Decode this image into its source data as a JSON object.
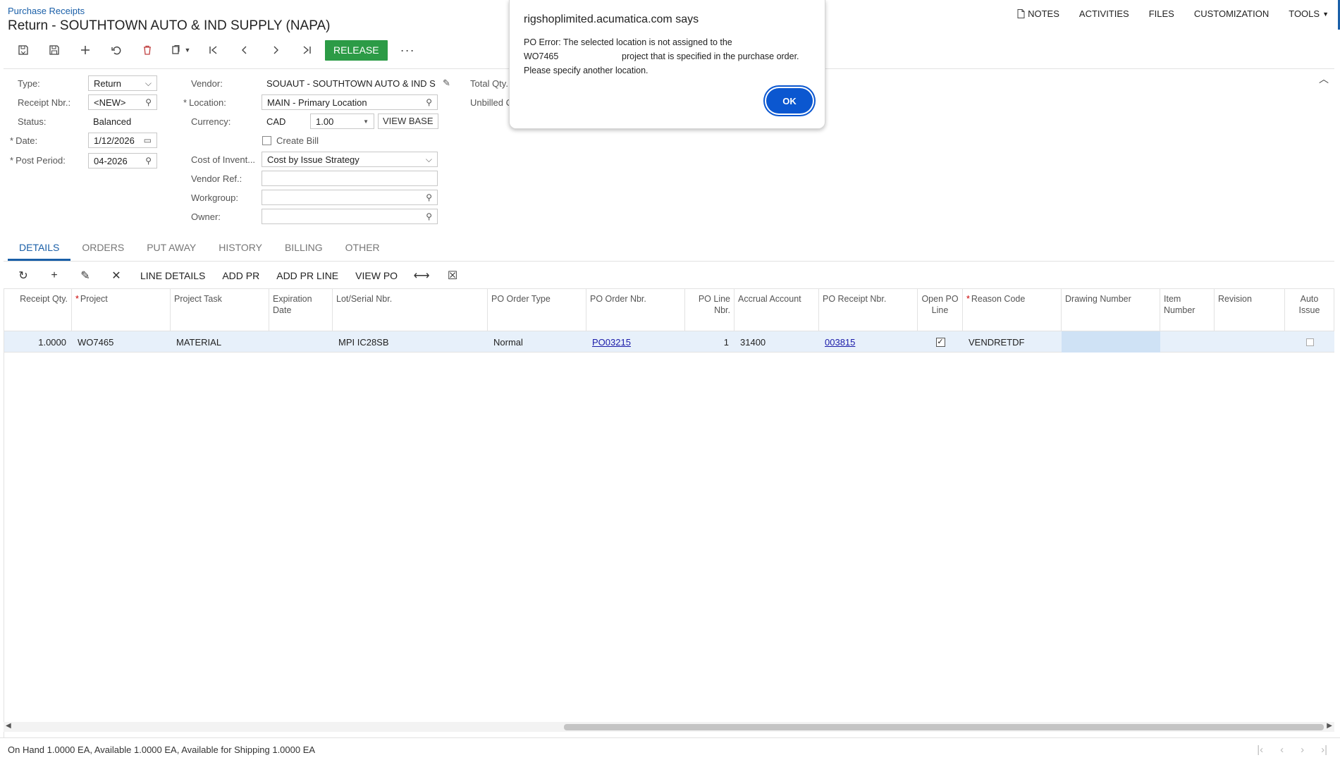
{
  "header": {
    "breadcrumb": "Purchase Receipts",
    "title": "Return - SOUTHTOWN AUTO & IND SUPPLY (NAPA)",
    "menu": {
      "notes": "NOTES",
      "activities": "ACTIVITIES",
      "files": "FILES",
      "customization": "CUSTOMIZATION",
      "tools": "TOOLS"
    }
  },
  "toolbar": {
    "release_label": "RELEASE",
    "more_label": "···"
  },
  "form": {
    "type_label": "Type:",
    "type_value": "Return",
    "receipt_nbr_label": "Receipt Nbr.:",
    "receipt_nbr_value": "<NEW>",
    "status_label": "Status:",
    "status_value": "Balanced",
    "date_label": "Date:",
    "date_value": "1/12/2026",
    "post_period_label": "Post Period:",
    "post_period_value": "04-2026",
    "vendor_label": "Vendor:",
    "vendor_value": "SOUAUT - SOUTHTOWN AUTO & IND S",
    "location_label": "Location:",
    "location_value": "MAIN - Primary Location",
    "currency_label": "Currency:",
    "currency_value": "CAD",
    "currency_rate": "1.00",
    "view_base_label": "VIEW BASE",
    "create_bill_label": "Create Bill",
    "cost_label": "Cost of Invent...",
    "cost_value": "Cost by Issue Strategy",
    "vendor_ref_label": "Vendor Ref.:",
    "vendor_ref_value": "",
    "workgroup_label": "Workgroup:",
    "workgroup_value": "",
    "owner_label": "Owner:",
    "owner_value": "",
    "total_qty_label": "Total Qty.",
    "unbilled_label": "Unbilled C"
  },
  "tabs": [
    "DETAILS",
    "ORDERS",
    "PUT AWAY",
    "HISTORY",
    "BILLING",
    "OTHER"
  ],
  "grid_toolbar": {
    "line_details": "LINE DETAILS",
    "add_pr": "ADD PR",
    "add_pr_line": "ADD PR LINE",
    "view_po": "VIEW PO"
  },
  "grid": {
    "headers": {
      "receipt_qty": "Receipt Qty.",
      "project": "Project",
      "project_task": "Project Task",
      "expiration_date": "Expiration Date",
      "lot_serial": "Lot/Serial Nbr.",
      "po_order_type": "PO Order Type",
      "po_order_nbr": "PO Order Nbr.",
      "po_line_nbr": "PO Line Nbr.",
      "accrual_account": "Accrual Account",
      "po_receipt_nbr": "PO Receipt Nbr.",
      "open_po_line": "Open PO Line",
      "reason_code": "Reason Code",
      "drawing_number": "Drawing Number",
      "item_number": "Item Number",
      "revision": "Revision",
      "auto_issue": "Auto Issue"
    },
    "rows": [
      {
        "receipt_qty": "1.0000",
        "project": "WO7465",
        "project_task": "MATERIAL",
        "expiration_date": "",
        "lot_serial": "MPI IC28SB",
        "po_order_type": "Normal",
        "po_order_nbr": "PO03215",
        "po_line_nbr": "1",
        "accrual_account": "31400",
        "po_receipt_nbr": "003815",
        "open_po_line": true,
        "reason_code": "VENDRETDF",
        "drawing_number": "",
        "item_number": "",
        "revision": "",
        "auto_issue": false
      }
    ]
  },
  "status_bar": {
    "text": "On Hand 1.0000 EA, Available 1.0000 EA, Available for Shipping 1.0000 EA"
  },
  "dialog": {
    "title": "rigshoplimited.acumatica.com says",
    "line1": "PO Error: The selected location is not assigned to the",
    "line2a": "WO7465",
    "line2b": "project that is specified in the purchase order.",
    "line3": "Please specify another location.",
    "ok_label": "OK"
  },
  "colors": {
    "accent": "#1a5fa8",
    "release": "#2c9b46",
    "dialog_button": "#0b57d0",
    "selected_row": "#e7f0fa"
  }
}
